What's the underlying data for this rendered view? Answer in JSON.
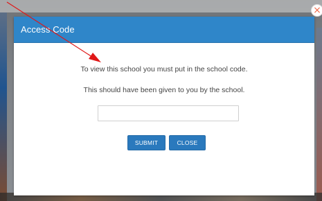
{
  "modal": {
    "title": "Access Code",
    "line1": "To view this school you must put in the school code.",
    "line2": "This should have been given to you by the school.",
    "input_value": "",
    "input_placeholder": "",
    "submit_label": "SUBMIT",
    "close_label": "CLOSE"
  },
  "controls": {
    "dismiss_glyph": "×"
  },
  "colors": {
    "header_blue": "#2f86c9",
    "button_blue": "#2a79bd",
    "annotation_red": "#e01818",
    "dismiss_orange": "#f06a4a"
  },
  "icons": {
    "close": "close-icon",
    "annotation_arrow": "arrow-icon"
  }
}
